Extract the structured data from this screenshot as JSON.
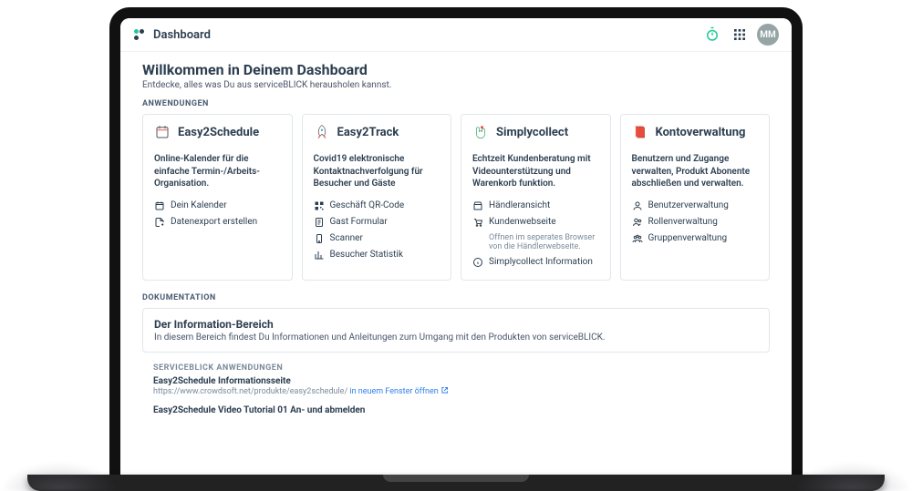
{
  "header": {
    "title": "Dashboard",
    "avatar": "MM"
  },
  "welcome": {
    "title": "Willkommen in Deinem Dashboard",
    "subtitle": "Entdecke, alles was Du aus serviceBLICK herausholen kannst."
  },
  "sections": {
    "apps_label": "ANWENDUNGEN",
    "docs_label": "DOKUMENTATION"
  },
  "cards": {
    "easy2schedule": {
      "title": "Easy2Schedule",
      "desc": "Online-Kalender für die einfache Termin-/Arbeits-Organisation.",
      "links": {
        "l0": "Dein Kalender",
        "l1": "Datenexport erstellen"
      }
    },
    "easy2track": {
      "title": "Easy2Track",
      "desc": "Covid19 elektronische Kontaktnachverfolgung für Besucher und Gäste",
      "links": {
        "l0": "Geschäft QR-Code",
        "l1": "Gast Formular",
        "l2": "Scanner",
        "l3": "Besucher Statistik"
      }
    },
    "simplycollect": {
      "title": "Simplycollect",
      "desc": "Echtzeit Kundenberatung mit Videounterstützung und Warenkorb funktion.",
      "links": {
        "l0": "Händleransicht",
        "l1": "Kundenwebseite",
        "note": "Offnen im seperates Browser von die Händlerwebseite.",
        "l2": "Simplycollect Information"
      }
    },
    "konto": {
      "title": "Kontoverwaltung",
      "desc": "Benutzern und Zugange verwalten, Produkt Abonente abschließen und verwalten.",
      "links": {
        "l0": "Benutzerverwaltung",
        "l1": "Rollenverwaltung",
        "l2": "Gruppenverwaltung"
      }
    }
  },
  "docs": {
    "title": "Der Information-Bereich",
    "subtitle": "In diesem Bereich findest Du Informationen und Anleitungen zum Umgang mit den Produkten von serviceBLICK.",
    "section_label": "SERVICEBLICK ANWENDUNGEN",
    "item1_title": "Easy2Schedule Informationsseite",
    "item1_url": "https://www.crowdsoft.net/produkte/easy2schedule/",
    "item1_link": "in neuem Fenster öffnen",
    "item2_title": "Easy2Schedule Video Tutorial 01 An- und abmelden"
  }
}
